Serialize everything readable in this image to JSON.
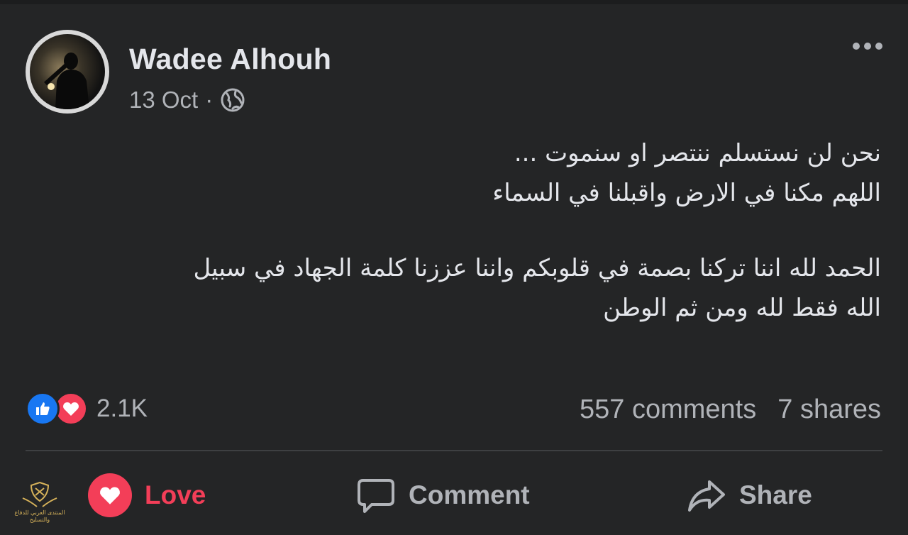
{
  "post": {
    "author": "Wadee Alhouh",
    "date": "13 Oct",
    "separator": "·",
    "privacy_icon": "globe-icon",
    "more_icon": "more-dots-icon",
    "text_lines_block1": [
      "نحن لن نستسلم ننتصر او سنموت ...",
      "اللهم مكنا في الارض واقبلنا في السماء"
    ],
    "text_lines_block2": [
      "الحمد لله اننا تركنا بصمة في قلوبكم واننا عززنا كلمة الجهاد في سبيل",
      "الله فقط لله ومن ثم الوطن"
    ]
  },
  "engagement": {
    "reaction_icons": [
      "like-icon",
      "love-icon"
    ],
    "reaction_count": "2.1K",
    "comments": "557 comments",
    "shares": "7 shares"
  },
  "actions": {
    "love_label": "Love",
    "comment_label": "Comment",
    "share_label": "Share"
  },
  "watermark": {
    "text": "المنتدى العربي للدفاع والتسليح"
  },
  "colors": {
    "background": "#242526",
    "primary_text": "#e4e6eb",
    "secondary_text": "#b0b3b8",
    "like_blue": "#1877f2",
    "love_red": "#f33e58"
  }
}
